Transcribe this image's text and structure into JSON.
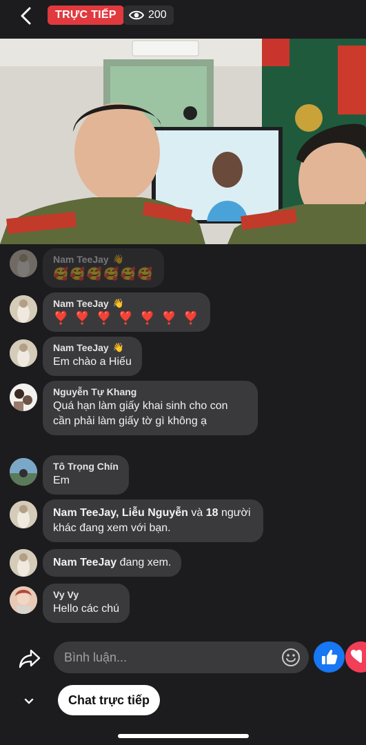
{
  "header": {
    "live_label": "TRỰC TIẾP",
    "viewer_count": "200",
    "back_icon": "chevron-left-icon",
    "viewer_icon": "eye-icon"
  },
  "colors": {
    "live": "#e0393e",
    "like": "#1877f2",
    "love": "#f33e58",
    "bubble": "#3a3a3c"
  },
  "comments": [
    {
      "name": "Nam TeeJay",
      "emoji": "🥰🥰🥰🥰🥰🥰",
      "faded": true
    },
    {
      "name": "Nam TeeJay",
      "emoji": "❣️ ❣️ ❣️ ❣️ ❣️ ❣️ ❣️"
    },
    {
      "name": "Nam TeeJay",
      "text": "Em chào a Hiếu"
    },
    {
      "name": "Nguyễn Tự Khang",
      "text": "Quá hạn làm giấy khai sinh cho con cần phải làm giấy tờ gì không ạ"
    },
    {
      "name": "Tô Trọng Chín",
      "text": "Em"
    },
    {
      "system": {
        "name1": "Nam TeeJay",
        "sep": ", ",
        "name2": "Liễu Nguyễn",
        "and": " và ",
        "count": "18",
        "rest": " người khác đang xem với bạn."
      }
    },
    {
      "system": {
        "name1": "Nam TeeJay",
        "rest": " đang xem."
      }
    },
    {
      "name": "Vy Vy",
      "text": "Hello các chú"
    }
  ],
  "composer": {
    "placeholder": "Bình luận...",
    "share_icon": "share-arrow-icon",
    "emoji_icon": "smiley-icon"
  },
  "footer": {
    "chat_label": "Chat trực tiếp",
    "collapse_icon": "chevron-down-icon"
  }
}
